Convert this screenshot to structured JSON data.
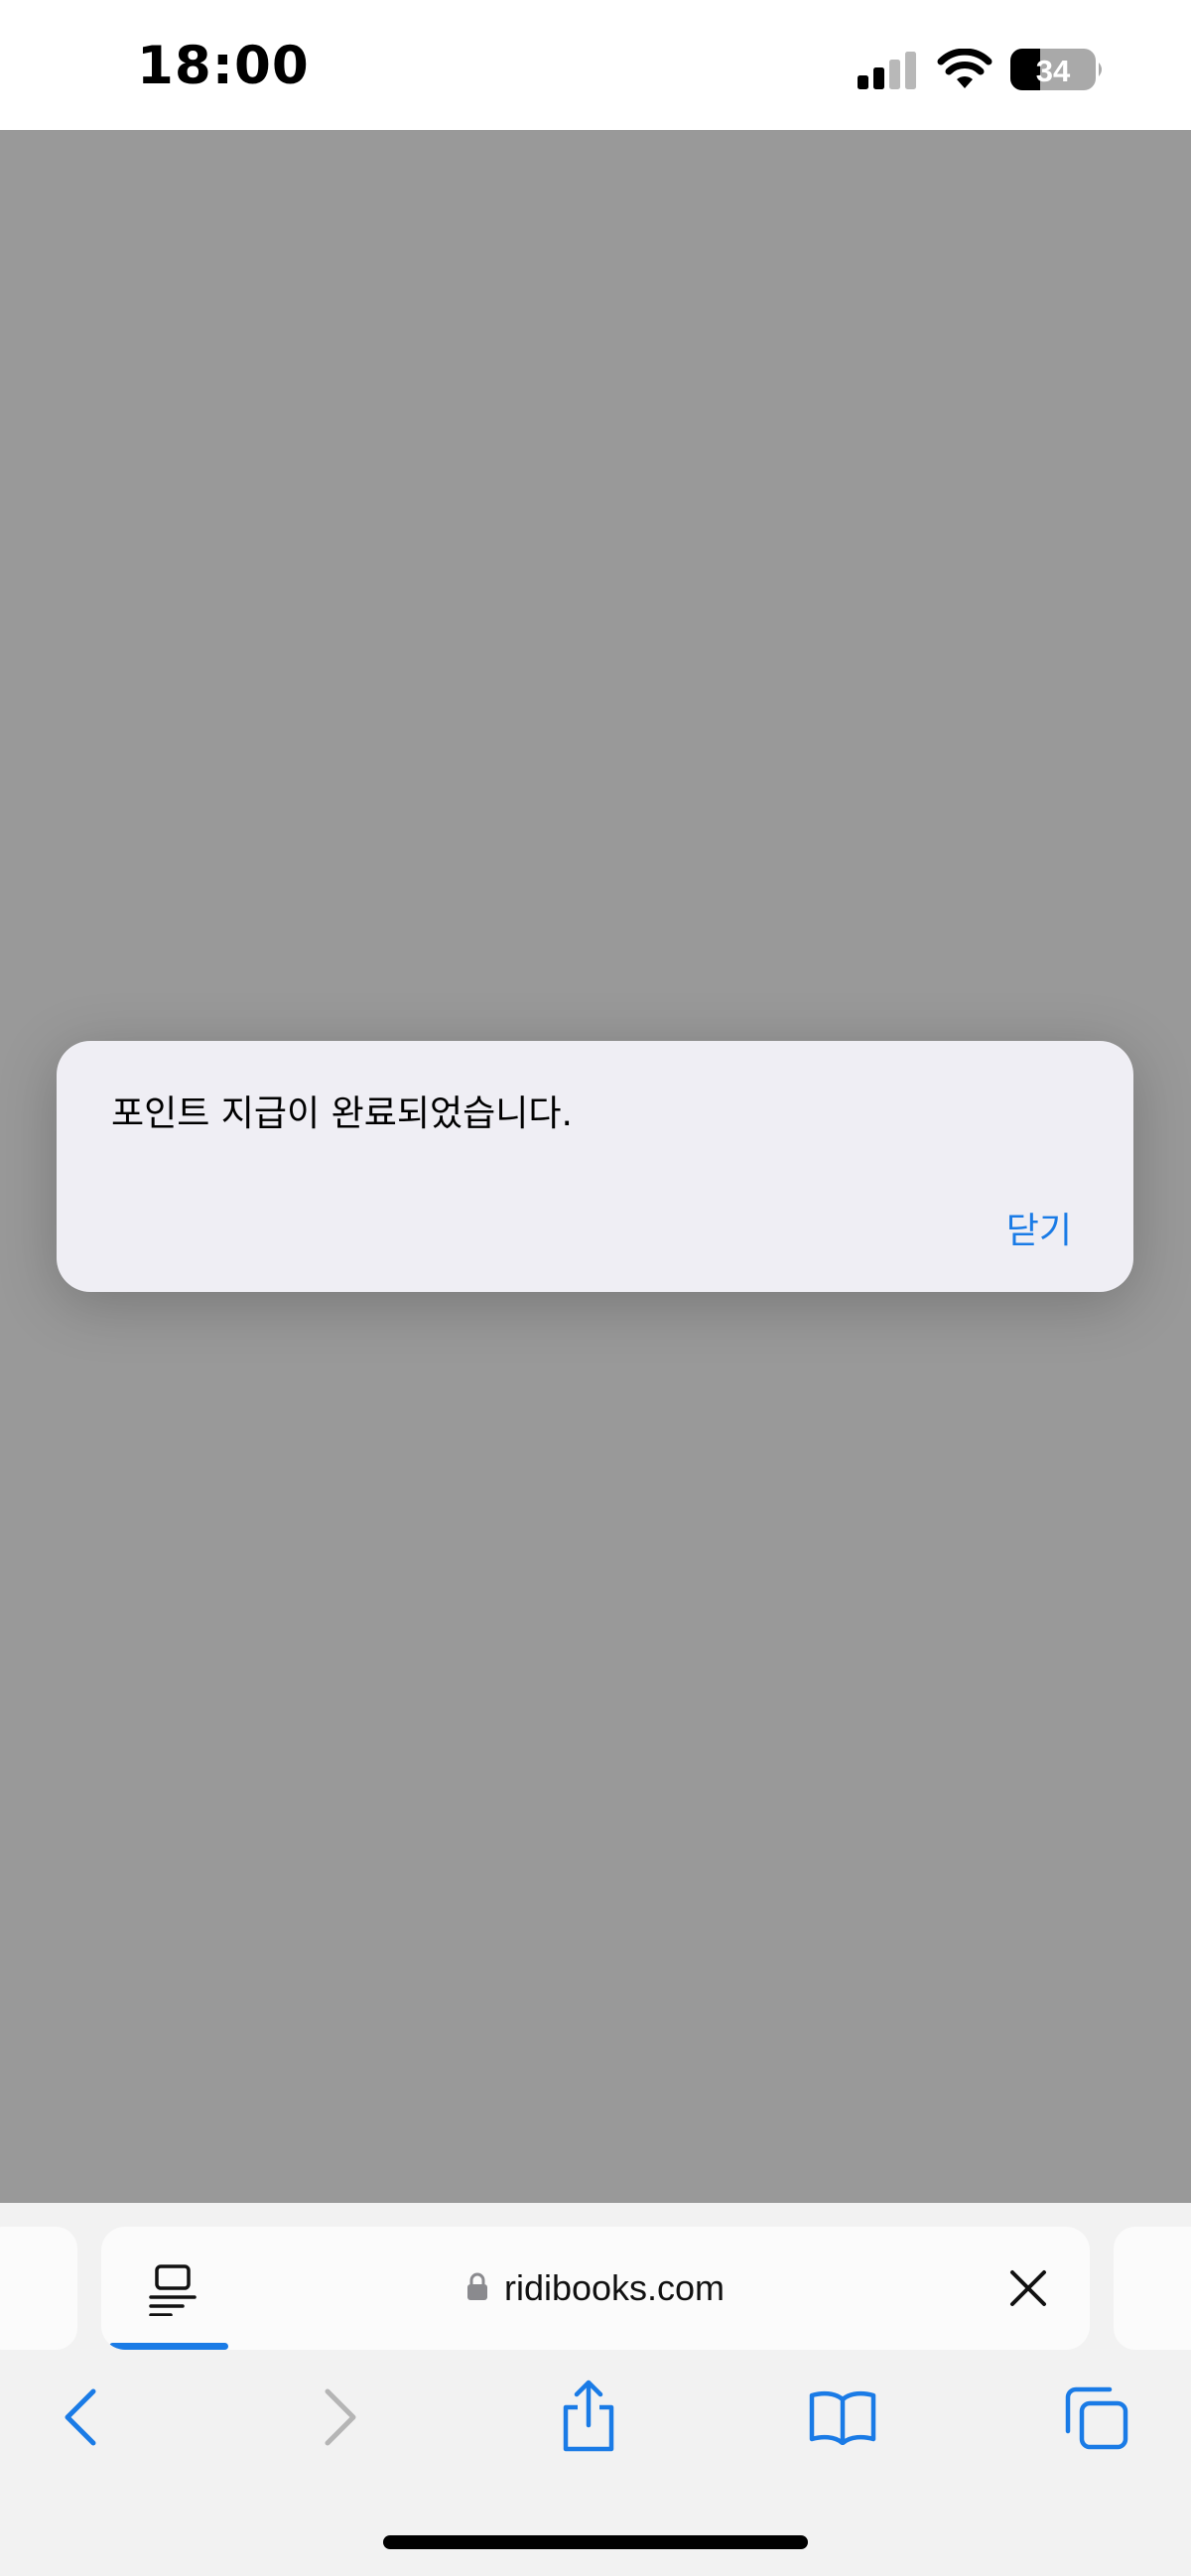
{
  "status_bar": {
    "time": "18:00",
    "battery_level": "34",
    "signal_icon": "cellular-signal-icon",
    "wifi_icon": "wifi-icon",
    "battery_icon": "battery-icon"
  },
  "alert": {
    "message": "포인트 지급이 완료되었습니다.",
    "close_label": "닫기"
  },
  "address_bar": {
    "url": "ridibooks.com",
    "reader_icon": "page-format-icon",
    "lock_icon": "lock-icon",
    "stop_icon": "close-icon",
    "load_progress": 0.12
  },
  "toolbar": {
    "back_icon": "chevron-left-icon",
    "forward_icon": "chevron-right-icon",
    "share_icon": "share-icon",
    "bookmarks_icon": "book-icon",
    "tabs_icon": "tabs-icon"
  },
  "colors": {
    "accent": "#1a7be6",
    "overlay": "#999999",
    "alert_background": "#efeef4",
    "disabled": "#b5b5b5"
  }
}
